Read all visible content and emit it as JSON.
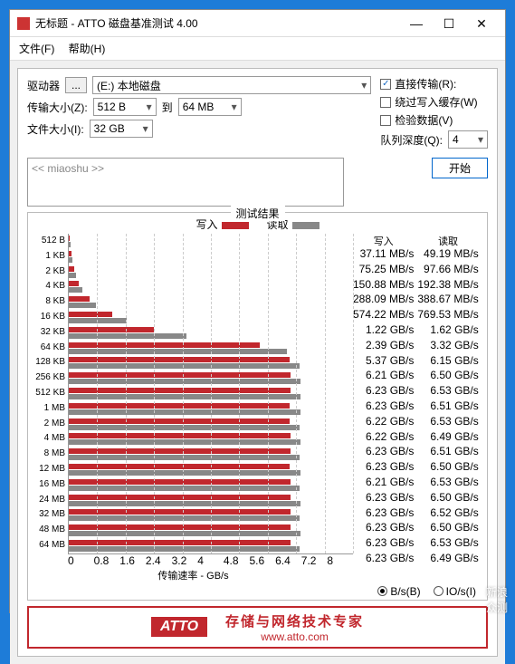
{
  "window": {
    "title": "无标题 - ATTO 磁盘基准测试 4.00",
    "menu": {
      "file": "文件(F)",
      "help": "帮助(H)"
    }
  },
  "form": {
    "drive_label": "驱动器",
    "drive_btn": "...",
    "drive_value": "(E:) 本地磁盘",
    "io_size_label": "传输大小(Z):",
    "io_from": "512 B",
    "io_to_label": "到",
    "io_to": "64 MB",
    "file_size_label": "文件大小(I):",
    "file_size": "32 GB",
    "opts": {
      "direct": {
        "label": "直接传输(R):",
        "checked": true
      },
      "bypass": {
        "label": "绕过写入缓存(W)",
        "checked": false
      },
      "verify": {
        "label": "检验数据(V)",
        "checked": false
      }
    },
    "queue_label": "队列深度(Q):",
    "queue_value": "4",
    "desc_placeholder": "<< miaoshu >>",
    "start": "开始"
  },
  "results": {
    "title": "测试结果",
    "write_label": "写入",
    "read_label": "读取",
    "xaxis": "传输速率 - GB/s",
    "xticks": [
      "0",
      "0.8",
      "1.6",
      "2.4",
      "3.2",
      "4",
      "4.8",
      "5.6",
      "6.4",
      "7.2",
      "8"
    ],
    "unit_bs": "B/s(B)",
    "unit_ios": "IO/s(I)"
  },
  "chart_data": {
    "type": "bar",
    "xlabel": "传输速率 - GB/s",
    "ylabel": "",
    "xlim": [
      0,
      8
    ],
    "categories": [
      "512 B",
      "1 KB",
      "2 KB",
      "4 KB",
      "8 KB",
      "16 KB",
      "32 KB",
      "64 KB",
      "128 KB",
      "256 KB",
      "512 KB",
      "1 MB",
      "2 MB",
      "4 MB",
      "8 MB",
      "12 MB",
      "16 MB",
      "24 MB",
      "32 MB",
      "48 MB",
      "64 MB"
    ],
    "series": [
      {
        "name": "写入",
        "unit": "GB/s",
        "values": [
          0.03711,
          0.07525,
          0.15088,
          0.28809,
          0.57422,
          1.22,
          2.39,
          5.37,
          6.21,
          6.23,
          6.23,
          6.22,
          6.22,
          6.23,
          6.23,
          6.21,
          6.23,
          6.23,
          6.23,
          6.23,
          6.23
        ],
        "display": [
          "37.11 MB/s",
          "75.25 MB/s",
          "150.88 MB/s",
          "288.09 MB/s",
          "574.22 MB/s",
          "1.22 GB/s",
          "2.39 GB/s",
          "5.37 GB/s",
          "6.21 GB/s",
          "6.23 GB/s",
          "6.23 GB/s",
          "6.22 GB/s",
          "6.22 GB/s",
          "6.23 GB/s",
          "6.23 GB/s",
          "6.21 GB/s",
          "6.23 GB/s",
          "6.23 GB/s",
          "6.23 GB/s",
          "6.23 GB/s",
          "6.23 GB/s"
        ]
      },
      {
        "name": "读取",
        "unit": "GB/s",
        "values": [
          0.04919,
          0.09766,
          0.19238,
          0.38867,
          0.76953,
          1.62,
          3.32,
          6.15,
          6.5,
          6.53,
          6.51,
          6.53,
          6.49,
          6.51,
          6.5,
          6.53,
          6.5,
          6.52,
          6.5,
          6.53,
          6.49
        ],
        "display": [
          "49.19 MB/s",
          "97.66 MB/s",
          "192.38 MB/s",
          "388.67 MB/s",
          "769.53 MB/s",
          "1.62 GB/s",
          "3.32 GB/s",
          "6.15 GB/s",
          "6.50 GB/s",
          "6.53 GB/s",
          "6.51 GB/s",
          "6.53 GB/s",
          "6.49 GB/s",
          "6.51 GB/s",
          "6.50 GB/s",
          "6.53 GB/s",
          "6.50 GB/s",
          "6.52 GB/s",
          "6.50 GB/s",
          "6.53 GB/s",
          "6.49 GB/s"
        ]
      }
    ]
  },
  "footer": {
    "logo": "ATTO",
    "tagline": "存储与网络技术专家",
    "url": "www.atto.com"
  },
  "watermark": {
    "l1": "新浪",
    "l2": "众测"
  }
}
